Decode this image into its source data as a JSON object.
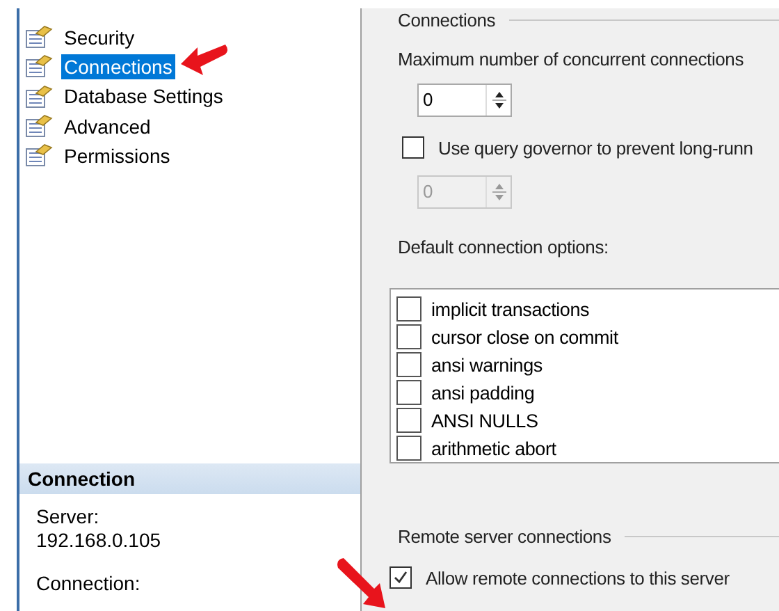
{
  "sidebar": {
    "items": [
      {
        "label": "Security",
        "selected": false
      },
      {
        "label": "Connections",
        "selected": true
      },
      {
        "label": "Database Settings",
        "selected": false
      },
      {
        "label": "Advanced",
        "selected": false
      },
      {
        "label": "Permissions",
        "selected": false
      }
    ]
  },
  "connection_panel": {
    "title": "Connection",
    "fields": [
      {
        "label": "Server:",
        "value": "192.168.0.105"
      },
      {
        "label": "Connection:"
      }
    ]
  },
  "connections_group": {
    "title": "Connections",
    "max_connections_label": "Maximum number of concurrent connections",
    "max_connections_value": "0",
    "query_governor": {
      "label": "Use query governor to prevent long-runn",
      "checked": false
    },
    "query_governor_value": {
      "value": "0",
      "disabled": true
    },
    "options_label": "Default connection options:",
    "options": [
      {
        "label": "implicit transactions",
        "checked": false
      },
      {
        "label": "cursor close on commit",
        "checked": false
      },
      {
        "label": "ansi warnings",
        "checked": false
      },
      {
        "label": "ansi padding",
        "checked": false
      },
      {
        "label": "ANSI NULLS",
        "checked": false
      },
      {
        "label": "arithmetic abort",
        "checked": false
      }
    ]
  },
  "remote_group": {
    "title": "Remote server connections",
    "allow_remote": {
      "label": "Allow remote connections to this server",
      "checked": true
    }
  }
}
